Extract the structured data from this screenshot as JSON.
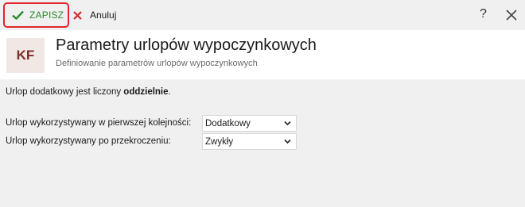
{
  "toolbar": {
    "save_label": "ZAPISZ",
    "cancel_label": "Anuluj",
    "help_label": "?",
    "save_color": "#2a8a2a",
    "highlight_color": "#e0262b"
  },
  "header": {
    "badge": "KF",
    "title": "Parametry urlopów wypoczynkowych",
    "subtitle": "Definiowanie parametrów urlopów wypoczynkowych",
    "badge_bg": "#f1e8e6",
    "badge_color": "#7a2e2a"
  },
  "info": {
    "prefix": "Urlop dodatkowy jest liczony ",
    "bold": "oddzielnie",
    "suffix": "."
  },
  "form": {
    "rows": [
      {
        "label": "Urlop wykorzystywany w pierwszej kolejności:",
        "value": "Dodatkowy"
      },
      {
        "label": "Urlop wykorzystywany po przekroczeniu:",
        "value": "Zwykły"
      }
    ]
  },
  "icons": [
    "check-icon",
    "close-x-icon",
    "help-icon",
    "window-close-icon",
    "chevron-down-icon"
  ]
}
